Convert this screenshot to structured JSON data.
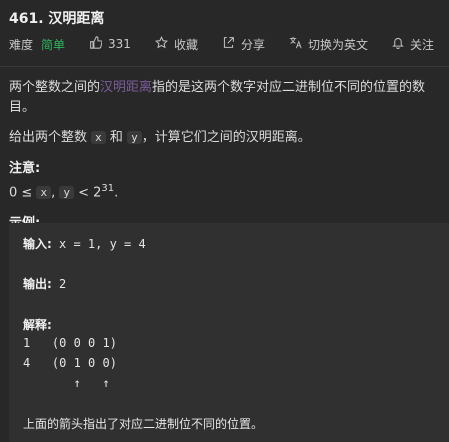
{
  "problem": {
    "title": "461. 汉明距离",
    "difficulty_label": "难度",
    "difficulty": "简单",
    "likes": "331",
    "favorite": "收藏",
    "share": "分享",
    "switch_lang": "切换为英文",
    "follow": "关注"
  },
  "description": {
    "p1_before": "两个整数之间的",
    "p1_link": "汉明距离",
    "p1_after": "指的是这两个数字对应二进制位不同的位置的数目。",
    "p2_a": "给出两个整数",
    "p2_x": "x",
    "p2_and": "和",
    "p2_y": "y",
    "p2_b": "，计算它们之间的汉明距离。",
    "note_title": "注意:",
    "note_prefix": "0 ≤",
    "note_x": "x",
    "note_comma": ",",
    "note_y": "y",
    "note_lt": "< 2",
    "note_exp": "31",
    "note_dot": ".",
    "example_title": "示例:"
  },
  "example": {
    "input_label": "输入:",
    "input_value": " x = 1, y = 4",
    "output_label": "输出:",
    "output_value": " 2",
    "explain_label": "解释:",
    "row1": "1   (0 0 0 1)",
    "row2": "4   (0 1 0 0)",
    "arrows": "       ↑   ↑",
    "footer": "上面的箭头指出了对应二进制位不同的位置。"
  },
  "icons": {
    "like": "thumbs-up-icon",
    "favorite": "star-icon",
    "share": "share-icon",
    "translate": "translate-icon",
    "follow": "bell-icon"
  },
  "colors": {
    "background": "#282828",
    "easy": "#2db55d",
    "link": "#7a5c9a",
    "code_block": "#303030"
  }
}
